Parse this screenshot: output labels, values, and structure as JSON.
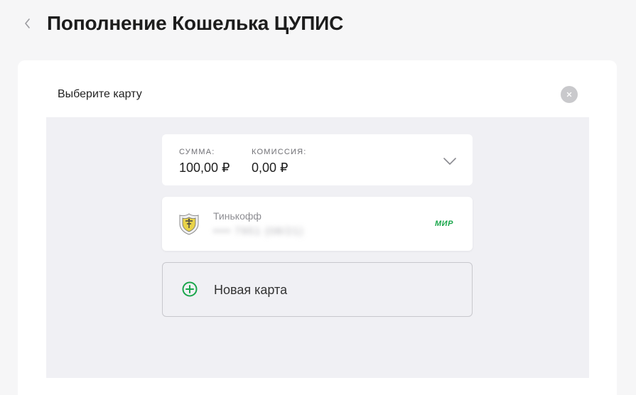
{
  "header": {
    "back_icon": "chevron-left-icon",
    "title": "Пополнение Кошелька ЦУПИС"
  },
  "dialog": {
    "title": "Выберите карту",
    "close_icon": "close-icon"
  },
  "summary": {
    "sum_label": "СУММА:",
    "sum_value": "100,00 ₽",
    "commission_label": "КОМИССИЯ:",
    "commission_value": "0,00 ₽",
    "expand_icon": "chevron-down-icon"
  },
  "saved_card": {
    "bank_name": "Тинькофф",
    "masked_number": "•••• 7951  (08/21)",
    "payment_system": "МИР",
    "bank_icon": "tinkoff-logo-icon"
  },
  "new_card": {
    "label": "Новая карта",
    "icon": "plus-circle-icon"
  },
  "colors": {
    "accent_green": "#1aa64b",
    "background": "#f6f6f7",
    "panel_gray": "#f0f0f4"
  }
}
